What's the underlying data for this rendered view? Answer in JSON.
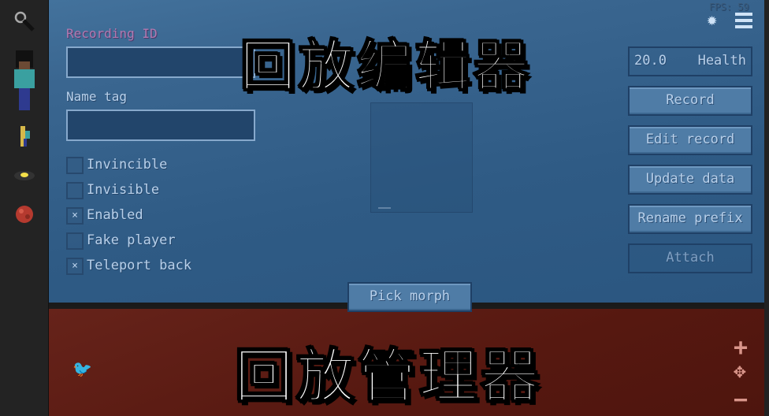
{
  "overlay": {
    "editor_title": "回放编辑器",
    "manager_title": "回放管理器"
  },
  "hud": {
    "fps": "FPS: 59"
  },
  "sidebar": {
    "items": [
      {
        "icon": "magnifier-icon"
      },
      {
        "icon": "player-morph-icon"
      },
      {
        "icon": "small-player-icon"
      },
      {
        "icon": "eye-disc-icon"
      },
      {
        "icon": "red-ore-icon"
      }
    ]
  },
  "form": {
    "recording_id_label": "Recording ID",
    "recording_id_value": "",
    "name_tag_label": "Name tag",
    "name_tag_value": "",
    "checkboxes": [
      {
        "label": "Invincible",
        "checked": false
      },
      {
        "label": "Invisible",
        "checked": false
      },
      {
        "label": "Enabled",
        "checked": true
      },
      {
        "label": "Fake player",
        "checked": false
      },
      {
        "label": "Teleport back",
        "checked": true
      }
    ],
    "check_mark": "×",
    "pick_morph": "Pick morph"
  },
  "right": {
    "health_value": "20.0",
    "health_label": "Health",
    "buttons": [
      "Record",
      "Edit record",
      "Update data",
      "Rename prefix",
      "Attach"
    ]
  },
  "manager": {
    "add": "+",
    "move": "✥",
    "remove": "−"
  }
}
